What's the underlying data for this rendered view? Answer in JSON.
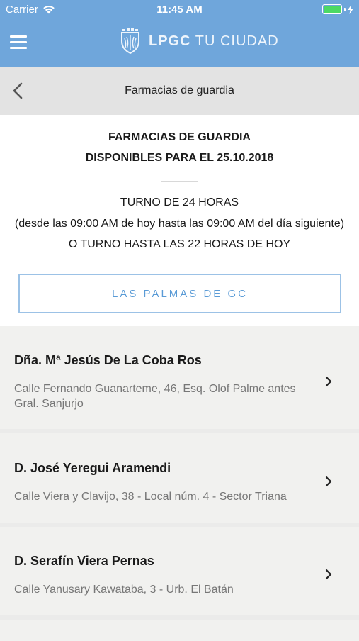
{
  "status_bar": {
    "carrier": "Carrier",
    "time": "11:45 AM",
    "battery_color": "#4cd964"
  },
  "header": {
    "title_bold": "LPGC",
    "title_rest": " TU CIUDAD",
    "background": "#6fa6db",
    "menu_icon": "hamburger-icon",
    "logo_icon": "city-shield-icon"
  },
  "nav": {
    "back_icon": "chevron-left-icon",
    "title": "Farmacias de guardia"
  },
  "intro": {
    "heading_line1": "FARMACIAS DE GUARDIA",
    "heading_line2": "DISPONIBLES PARA EL 25.10.2018",
    "turno_line1": "TURNO DE 24 HORAS",
    "turno_line2": "(desde las 09:00 AM de hoy hasta las 09:00 AM del día siguiente)",
    "turno_line3": "O TURNO HASTA LAS 22 HORAS DE HOY",
    "city_button": "LAS PALMAS DE GC",
    "accent": "#5a9bd6"
  },
  "pharmacies": [
    {
      "name": "Dña. Mª Jesús De La Coba Ros",
      "address": "Calle Fernando Guanarteme, 46, Esq. Olof Palme antes Gral. Sanjurjo"
    },
    {
      "name": "D. José Yeregui Aramendi",
      "address": "Calle Viera y Clavijo, 38 - Local núm. 4 - Sector Triana"
    },
    {
      "name": "D. Serafín Viera Pernas",
      "address": "Calle Yanusary Kawataba, 3 - Urb. El Batán"
    }
  ]
}
